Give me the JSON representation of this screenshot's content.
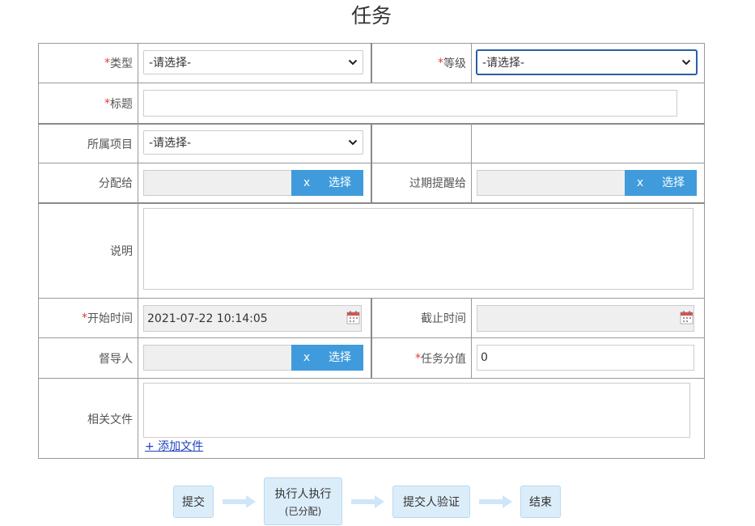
{
  "page": {
    "title": "任务"
  },
  "form": {
    "type": {
      "required": "*",
      "label": "类型",
      "value": "-请选择-"
    },
    "level": {
      "required": "*",
      "label": "等级",
      "value": "-请选择-"
    },
    "title": {
      "required": "*",
      "label": "标题"
    },
    "project": {
      "label": "所属项目",
      "value": "-请选择-"
    },
    "assignee": {
      "label": "分配给",
      "clear_label": "x",
      "select_label": "选择"
    },
    "overdue_notify": {
      "label": "过期提醒给",
      "clear_label": "x",
      "select_label": "选择"
    },
    "description": {
      "label": "说明"
    },
    "start_time": {
      "required": "*",
      "label": "开始时间",
      "value": "2021-07-22 10:14:05"
    },
    "end_time": {
      "label": "截止时间"
    },
    "supervisor": {
      "label": "督导人",
      "clear_label": "x",
      "select_label": "选择"
    },
    "score": {
      "required": "*",
      "label": "任务分值",
      "value": "0"
    },
    "files": {
      "label": "相关文件",
      "add_link": "+ 添加文件"
    }
  },
  "flow": {
    "steps": [
      {
        "label": "提交"
      },
      {
        "label": "执行人执行",
        "sublabel": "(已分配)"
      },
      {
        "label": "提交人验证"
      },
      {
        "label": "结束"
      }
    ]
  },
  "icons": {
    "select": "chevron-down-icon",
    "date": "calendar-icon",
    "flow": "arrow-right-icon"
  },
  "colors": {
    "accent": "#3f9bdb",
    "required": "#e53935",
    "flow_box": "#dcedfa",
    "link": "#1f3fbf"
  }
}
